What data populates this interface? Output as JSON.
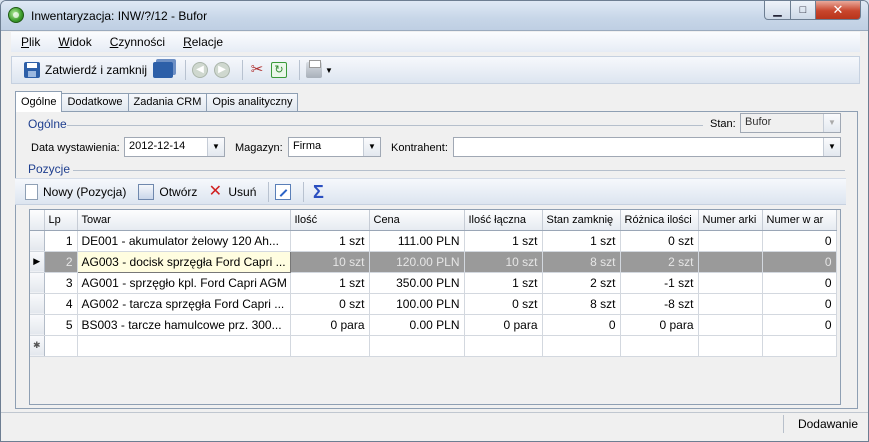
{
  "window": {
    "title": "Inwentaryzacja: INW/?/12 - Bufor",
    "min_glyph": "▁",
    "max_glyph": "□",
    "close_glyph": "✕"
  },
  "menu": [
    "Plik",
    "Widok",
    "Czynności",
    "Relacje"
  ],
  "toolbar": {
    "save_close_label": "Zatwierdź i zamknij"
  },
  "tabs": [
    "Ogólne",
    "Dodatkowe",
    "Zadania CRM",
    "Opis analityczny"
  ],
  "general": {
    "section_title": "Ogólne",
    "stan_label": "Stan:",
    "stan_value": "Bufor",
    "date_label": "Data wystawienia:",
    "date_value": "2012-12-14",
    "magazyn_label": "Magazyn:",
    "magazyn_value": "Firma",
    "kontrahent_label": "Kontrahent:",
    "kontrahent_value": ""
  },
  "positions": {
    "section_title": "Pozycje",
    "new_label": "Nowy (Pozycja)",
    "open_label": "Otwórz",
    "delete_label": "Usuń"
  },
  "grid": {
    "columns": [
      "Lp",
      "Towar",
      "Ilość",
      "Cena",
      "Ilość łączna",
      "Stan zamknię",
      "Różnica ilości",
      "Numer arki",
      "Numer w ar"
    ],
    "rows": [
      {
        "lp": "1",
        "towar": "DE001 - akumulator żelowy 120 Ah...",
        "ilosc": "1 szt",
        "cena": "111.00 PLN",
        "ilosc_laczna": "1 szt",
        "stan": "1 szt",
        "roznica": "0 szt",
        "numer_arki": "",
        "numer_w_ar": "0",
        "selected": false
      },
      {
        "lp": "2",
        "towar": "AG003 - docisk sprzęgła Ford Capri ...",
        "ilosc": "10 szt",
        "cena": "120.00 PLN",
        "ilosc_laczna": "10 szt",
        "stan": "8 szt",
        "roznica": "2 szt",
        "numer_arki": "",
        "numer_w_ar": "0",
        "selected": true
      },
      {
        "lp": "3",
        "towar": "AG001 - sprzęgło kpl. Ford Capri AGM",
        "ilosc": "1 szt",
        "cena": "350.00 PLN",
        "ilosc_laczna": "1 szt",
        "stan": "2 szt",
        "roznica": "-1 szt",
        "numer_arki": "",
        "numer_w_ar": "0",
        "selected": false
      },
      {
        "lp": "4",
        "towar": "AG002 - tarcza sprzęgła Ford Capri ...",
        "ilosc": "0 szt",
        "cena": "100.00 PLN",
        "ilosc_laczna": "0 szt",
        "stan": "8 szt",
        "roznica": "-8 szt",
        "numer_arki": "",
        "numer_w_ar": "0",
        "selected": false
      },
      {
        "lp": "5",
        "towar": "BS003 - tarcze hamulcowe prz. 300...",
        "ilosc": "0 para",
        "cena": "0.00 PLN",
        "ilosc_laczna": "0 para",
        "stan": "0",
        "roznica": "0 para",
        "numer_arki": "",
        "numer_w_ar": "0",
        "selected": false
      }
    ],
    "current_row_marker": "▶",
    "new_row_marker": "✱"
  },
  "status": {
    "mode": "Dodawanie"
  }
}
